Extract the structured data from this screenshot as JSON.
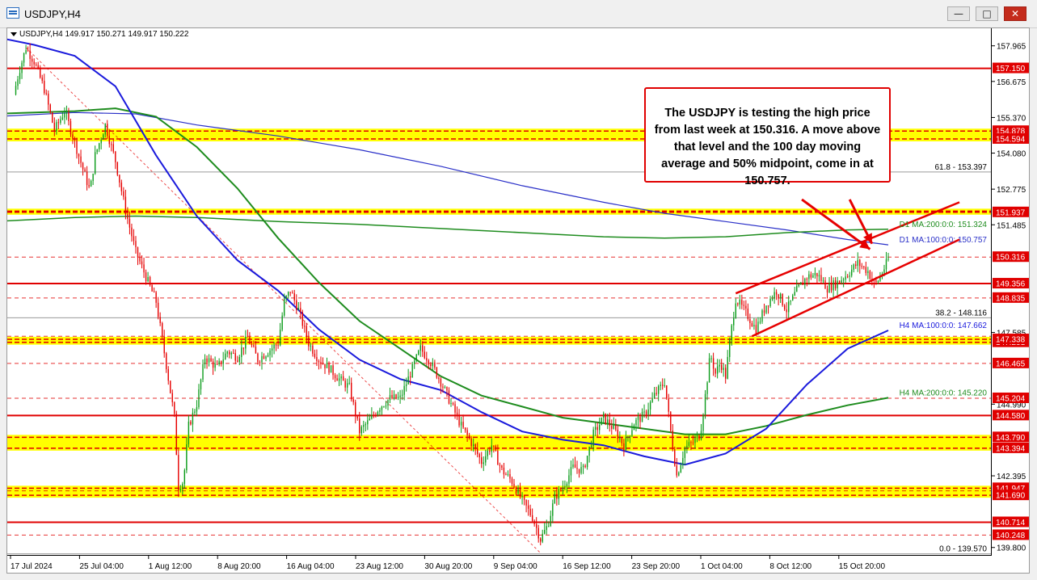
{
  "window": {
    "title": "USDJPY,H4",
    "icon": "chart-window-icon",
    "buttons": [
      {
        "name": "minimize-button",
        "glyph": "—"
      },
      {
        "name": "maximize-button",
        "glyph": "□"
      },
      {
        "name": "close-button",
        "glyph": "✕"
      }
    ]
  },
  "ohlc_label": "USDJPY,H4  149.917 150.271 149.917 150.222",
  "annotation_text": "The USDJPY is testing the high price from last week at 150.316.  A move above that level and the 100 day moving average and 50% midpoint, come in at 150.757.",
  "colors": {
    "up": "#0a9b1a",
    "down": "#e60000",
    "ma_blue": "#1a1adc",
    "ma_green": "#1e8c1e",
    "ma_navy": "#2a30c8",
    "level_line": "#e00000",
    "zone": "#ffff00",
    "price_box": "#e00000"
  },
  "chart_data": {
    "type": "candlestick",
    "symbol": "USDJPY",
    "timeframe": "H4",
    "ylim": [
      139.5,
      158.6
    ],
    "x_tick_labels": [
      "17 Jul 2024",
      "25 Jul 04:00",
      "1 Aug 12:00",
      "8 Aug 20:00",
      "16 Aug 04:00",
      "23 Aug 12:00",
      "30 Aug 20:00",
      "9 Sep 04:00",
      "16 Sep 12:00",
      "23 Sep 20:00",
      "1 Oct 04:00",
      "8 Oct 12:00",
      "15 Oct 20:00"
    ],
    "y_tick_labels": [
      157.965,
      156.675,
      155.37,
      154.08,
      152.775,
      151.485,
      147.585,
      144.99,
      142.395,
      139.8
    ],
    "price_boxes": [
      157.15,
      154.878,
      154.594,
      151.937,
      150.316,
      149.356,
      148.835,
      147.338,
      146.465,
      145.204,
      144.58,
      143.79,
      143.394,
      141.947,
      141.69,
      140.714,
      140.248
    ],
    "price_boxes_overlapped": [
      147.231
    ],
    "zones": [
      [
        154.594,
        154.878
      ],
      [
        151.937,
        151.98
      ],
      [
        147.231,
        147.338
      ],
      [
        143.394,
        143.79
      ],
      [
        141.69,
        141.947
      ]
    ],
    "solid_levels": [
      157.15,
      149.356,
      144.58,
      140.714
    ],
    "dashed_levels": [
      150.316,
      148.835,
      146.465,
      145.204,
      140.248,
      147.45,
      141.85
    ],
    "fib_levels": [
      {
        "label": "61.8 - 153.397",
        "value": 153.397
      },
      {
        "label": "38.2 - 148.116",
        "value": 148.116
      },
      {
        "label": "0.0 - 139.570",
        "value": 139.57
      }
    ],
    "ma_labels": [
      {
        "label": "D1 MA:200:0:0: 151.324",
        "value": 151.324,
        "color": "#1e8c1e"
      },
      {
        "label": "D1 MA:100:0:0: 150.757",
        "value": 150.757,
        "color": "#2a30c8"
      },
      {
        "label": "H4 MA:100:0:0: 147.662",
        "value": 147.662,
        "color": "#1a1adc"
      },
      {
        "label": "H4 MA:200:0:0: 145.220",
        "value": 145.22,
        "color": "#1e8c1e"
      }
    ],
    "close_path": [
      [
        0,
        156.2
      ],
      [
        0.5,
        157.0
      ],
      [
        1.2,
        157.9
      ],
      [
        2,
        157.4
      ],
      [
        3,
        156.4
      ],
      [
        4,
        154.9
      ],
      [
        5,
        155.6
      ],
      [
        5.8,
        154.7
      ],
      [
        6.8,
        153.5
      ],
      [
        7.5,
        152.7
      ],
      [
        8,
        154.0
      ],
      [
        9,
        155.1
      ],
      [
        10,
        153.8
      ],
      [
        11,
        152.0
      ],
      [
        12,
        150.5
      ],
      [
        13,
        149.6
      ],
      [
        14,
        148.7
      ],
      [
        15,
        146.4
      ],
      [
        15.8,
        144.5
      ],
      [
        16.2,
        142.0
      ],
      [
        16.7,
        142.2
      ],
      [
        17.2,
        144.2
      ],
      [
        18,
        145.0
      ],
      [
        18.8,
        146.7
      ],
      [
        20,
        146.3
      ],
      [
        21,
        146.9
      ],
      [
        22,
        146.7
      ],
      [
        23,
        147.4
      ],
      [
        24,
        146.6
      ],
      [
        25,
        146.9
      ],
      [
        26,
        147.2
      ],
      [
        26.6,
        148.7
      ],
      [
        27.2,
        149.1
      ],
      [
        28,
        148.4
      ],
      [
        29,
        147.2
      ],
      [
        30,
        146.6
      ],
      [
        31,
        146.3
      ],
      [
        32,
        145.9
      ],
      [
        33,
        145.6
      ],
      [
        34,
        144.0
      ],
      [
        35,
        144.4
      ],
      [
        36,
        144.9
      ],
      [
        37,
        145.2
      ],
      [
        38,
        145.2
      ],
      [
        39,
        146.1
      ],
      [
        40,
        147.0
      ],
      [
        41,
        146.5
      ],
      [
        42,
        145.8
      ],
      [
        43,
        145.0
      ],
      [
        44,
        144.2
      ],
      [
        45,
        143.6
      ],
      [
        46,
        142.9
      ],
      [
        47,
        143.5
      ],
      [
        48,
        142.6
      ],
      [
        49,
        142.2
      ],
      [
        50,
        141.5
      ],
      [
        51,
        140.9
      ],
      [
        51.8,
        140.1
      ],
      [
        52.5,
        140.6
      ],
      [
        53.2,
        141.6
      ],
      [
        54,
        142.0
      ],
      [
        55,
        142.7
      ],
      [
        56,
        142.6
      ],
      [
        57,
        143.9
      ],
      [
        58,
        144.5
      ],
      [
        59,
        144.1
      ],
      [
        60,
        143.5
      ],
      [
        61,
        144.3
      ],
      [
        62,
        144.6
      ],
      [
        63,
        145.3
      ],
      [
        64,
        145.8
      ],
      [
        64.6,
        144.0
      ],
      [
        65.2,
        142.4
      ],
      [
        66,
        143.4
      ],
      [
        66.8,
        143.6
      ],
      [
        67.5,
        143.9
      ],
      [
        68,
        145.3
      ],
      [
        68.5,
        146.8
      ],
      [
        69,
        146.1
      ],
      [
        69.5,
        146.5
      ],
      [
        70,
        146.0
      ],
      [
        70.5,
        147.5
      ],
      [
        71,
        148.8
      ],
      [
        72,
        148.3
      ],
      [
        73,
        147.7
      ],
      [
        74,
        148.6
      ],
      [
        75,
        149.1
      ],
      [
        76,
        148.4
      ],
      [
        77,
        149.1
      ],
      [
        78,
        149.6
      ],
      [
        79,
        149.7
      ],
      [
        80,
        149.2
      ],
      [
        81,
        149.4
      ],
      [
        82,
        149.7
      ],
      [
        83,
        150.1
      ],
      [
        84,
        149.8
      ],
      [
        84.7,
        149.3
      ],
      [
        85.2,
        149.6
      ],
      [
        86,
        150.22
      ]
    ],
    "n_bars": 86,
    "ma_h4_100": [
      [
        -2,
        158.3
      ],
      [
        2,
        158.0
      ],
      [
        6,
        157.6
      ],
      [
        10,
        156.5
      ],
      [
        14,
        154.0
      ],
      [
        18,
        151.8
      ],
      [
        22,
        150.2
      ],
      [
        26,
        149.1
      ],
      [
        30,
        147.7
      ],
      [
        34,
        146.6
      ],
      [
        38,
        145.9
      ],
      [
        42,
        145.5
      ],
      [
        46,
        144.7
      ],
      [
        50,
        144.0
      ],
      [
        54,
        143.7
      ],
      [
        58,
        143.5
      ],
      [
        62,
        143.1
      ],
      [
        66,
        142.8
      ],
      [
        70,
        143.2
      ],
      [
        74,
        144.1
      ],
      [
        78,
        145.7
      ],
      [
        82,
        147.0
      ],
      [
        86,
        147.66
      ]
    ],
    "ma_h4_200": [
      [
        -2,
        155.5
      ],
      [
        6,
        155.6
      ],
      [
        10,
        155.7
      ],
      [
        14,
        155.4
      ],
      [
        18,
        154.3
      ],
      [
        22,
        152.8
      ],
      [
        26,
        151.0
      ],
      [
        30,
        149.4
      ],
      [
        34,
        148.0
      ],
      [
        38,
        147.0
      ],
      [
        42,
        146.0
      ],
      [
        46,
        145.3
      ],
      [
        50,
        144.9
      ],
      [
        54,
        144.5
      ],
      [
        58,
        144.3
      ],
      [
        62,
        144.1
      ],
      [
        66,
        143.9
      ],
      [
        70,
        143.9
      ],
      [
        74,
        144.2
      ],
      [
        78,
        144.6
      ],
      [
        82,
        144.95
      ],
      [
        86,
        145.22
      ]
    ],
    "ma_d1_200": [
      [
        -2,
        151.6
      ],
      [
        6,
        151.75
      ],
      [
        12,
        151.8
      ],
      [
        18,
        151.75
      ],
      [
        26,
        151.6
      ],
      [
        34,
        151.5
      ],
      [
        42,
        151.35
      ],
      [
        50,
        151.2
      ],
      [
        58,
        151.05
      ],
      [
        64,
        151.0
      ],
      [
        70,
        151.05
      ],
      [
        76,
        151.2
      ],
      [
        82,
        151.3
      ],
      [
        86,
        151.324
      ]
    ],
    "ma_d1_100": [
      [
        -2,
        155.4
      ],
      [
        6,
        155.55
      ],
      [
        12,
        155.5
      ],
      [
        18,
        155.1
      ],
      [
        26,
        154.7
      ],
      [
        34,
        154.2
      ],
      [
        42,
        153.6
      ],
      [
        50,
        152.9
      ],
      [
        58,
        152.3
      ],
      [
        64,
        151.9
      ],
      [
        70,
        151.6
      ],
      [
        76,
        151.3
      ],
      [
        82,
        150.95
      ],
      [
        86,
        150.757
      ]
    ],
    "wedge_upper": [
      [
        71,
        149.0
      ],
      [
        93,
        152.3
      ]
    ],
    "wedge_lower": [
      [
        72.6,
        147.45
      ],
      [
        93,
        150.95
      ]
    ],
    "fib_diagonal": [
      [
        1.2,
        157.9
      ],
      [
        51.8,
        139.6
      ]
    ],
    "arrows": [
      {
        "from": [
          77.5,
          152.4
        ],
        "to": [
          84.2,
          150.6
        ]
      },
      {
        "from": [
          82.2,
          152.4
        ],
        "to": [
          84.4,
          150.8
        ]
      }
    ]
  }
}
